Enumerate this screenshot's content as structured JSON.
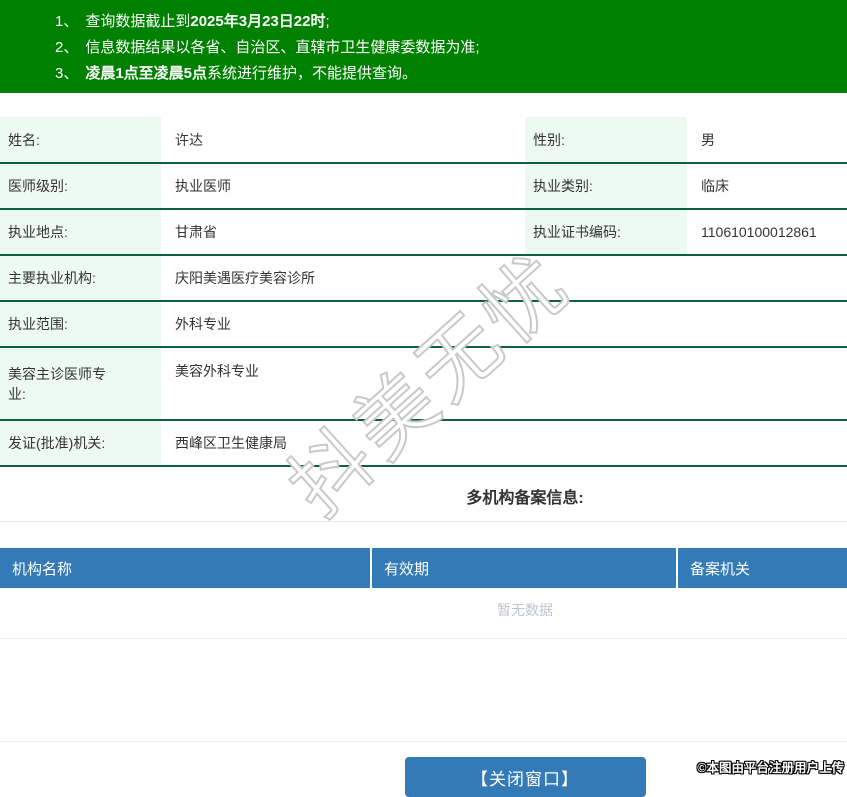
{
  "header": {
    "notes": [
      {
        "num": "1、",
        "pre": "查询数据截止到",
        "bold": "2025年3月23日22时",
        "post": ";"
      },
      {
        "num": "2、",
        "pre": "信息数据结果以各省、自治区、直辖市卫生健康委数据为准;",
        "bold": "",
        "post": ""
      },
      {
        "num": "3、",
        "pre": "",
        "bold": "凌晨1点至凌晨5点",
        "post": "系统进行维护，不能提供查询。"
      }
    ]
  },
  "info": {
    "rows4": [
      {
        "label1": "姓名:",
        "value1": "许达",
        "label2": "性别:",
        "value2": "男"
      },
      {
        "label1": "医师级别:",
        "value1": "执业医师",
        "label2": "执业类别:",
        "value2": "临床"
      },
      {
        "label1": "执业地点:",
        "value1": "甘肃省",
        "label2": "执业证书编码:",
        "value2": "110610100012861"
      }
    ],
    "rows_full": [
      {
        "label": "主要执业机构:",
        "value": "庆阳美遇医疗美容诊所"
      },
      {
        "label": "执业范围:",
        "value": "外科专业"
      },
      {
        "label": "美容主诊医师专业:",
        "value": "美容外科专业"
      },
      {
        "label": "发证(批准)机关:",
        "value": "西峰区卫生健康局"
      }
    ]
  },
  "filing": {
    "title": "多机构备案信息:",
    "columns": [
      "机构名称",
      "有效期",
      "备案机关"
    ],
    "empty_text": "暂无数据"
  },
  "footer": {
    "close_button": "【关闭窗口】",
    "copyright": "©本图由平台注册用户上传"
  },
  "watermark": {
    "text": "抖美无忧"
  },
  "colors": {
    "header_green": "#008000",
    "table_border_green": "#0d6140",
    "label_bg_mint": "#edfaf2",
    "accent_blue": "#337ab7",
    "empty_text_gray": "#c0c4cc"
  }
}
